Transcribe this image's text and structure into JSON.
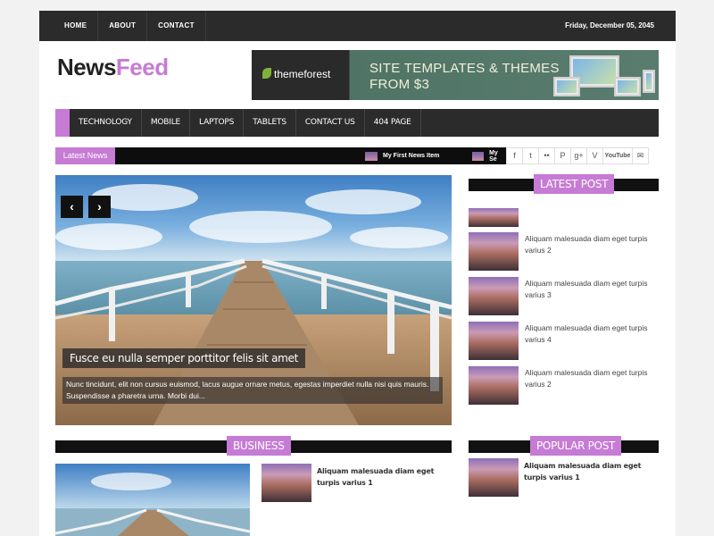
{
  "topbar": {
    "nav": [
      "HOME",
      "ABOUT",
      "CONTACT"
    ],
    "date": "Friday, December 05, 2045"
  },
  "logo": {
    "part1": "News",
    "part2": "Feed"
  },
  "banner": {
    "brand": "themeforest",
    "line1": "SITE TEMPLATES & THEMES",
    "line2": "FROM $3"
  },
  "mainnav": [
    "TECHNOLOGY",
    "MOBILE",
    "LAPTOPS",
    "TABLETS",
    "CONTACT US",
    "404 PAGE"
  ],
  "ticker": {
    "label": "Latest News",
    "items": [
      "My First News Item",
      "My Se"
    ]
  },
  "social": [
    "f",
    "t",
    "••",
    "P",
    "g+",
    "V",
    "YouTube",
    "✉"
  ],
  "slider": {
    "title": "Fusce eu nulla semper porttitor felis sit amet",
    "body": "Nunc tincidunt, elit non cursus euismod, lacus augue ornare metus, egestas imperdiet nulla nisi quis mauris. Suspendisse a pharetra urna. Morbi dui...",
    "prev_icon": "chevron-left-icon",
    "next_icon": "chevron-right-icon"
  },
  "latest_post": {
    "title": "LATEST POST",
    "items": [
      "",
      "Aliquam malesuada diam eget turpis varius 2",
      "Aliquam malesuada diam eget turpis varius 3",
      "Aliquam malesuada diam eget turpis varius 4",
      "Aliquam malesuada diam eget turpis varius 2"
    ]
  },
  "business": {
    "title": "BUSINESS",
    "side_item": "Aliquam malesuada diam eget turpis varius 1"
  },
  "popular_post": {
    "title": "POPULAR POST",
    "items": [
      "Aliquam malesuada diam eget turpis varius 1"
    ]
  },
  "colors": {
    "accent": "#c67bd4",
    "dark": "#2b2b2b"
  }
}
